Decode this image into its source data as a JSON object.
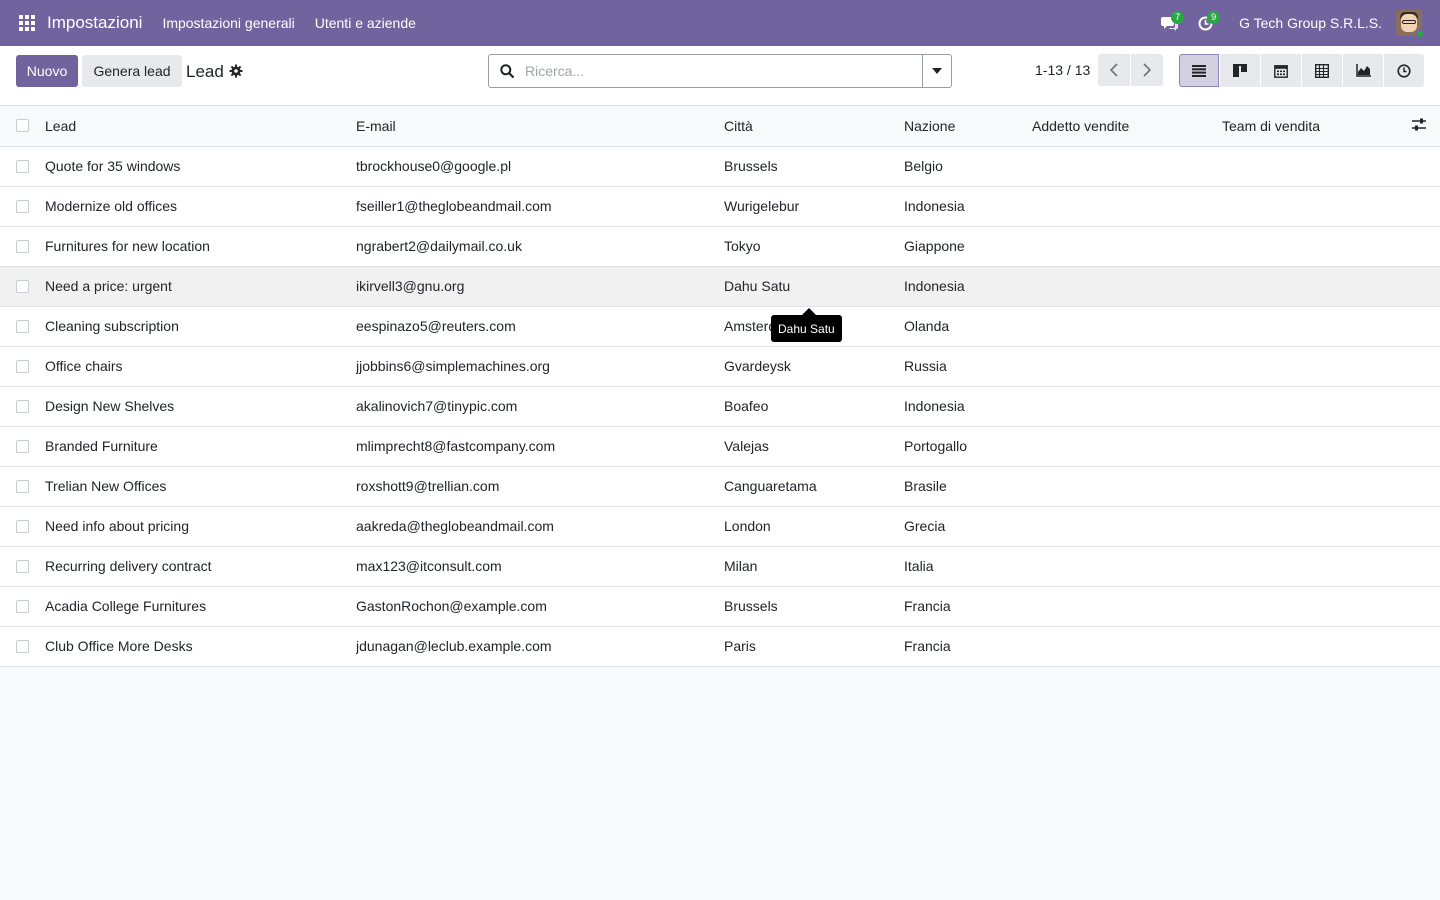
{
  "navbar": {
    "app_name": "Impostazioni",
    "menu": [
      "Impostazioni generali",
      "Utenti e aziende"
    ],
    "messages_count": "7",
    "activities_count": "9",
    "company": "G Tech Group S.R.L.S."
  },
  "control": {
    "new_label": "Nuovo",
    "generate_label": "Genera lead",
    "breadcrumb": "Lead",
    "search_placeholder": "Ricerca...",
    "pager": "1-13 / 13"
  },
  "columns": [
    "Lead",
    "E-mail",
    "Città",
    "Nazione",
    "Addetto vendite",
    "Team di vendita"
  ],
  "rows": [
    {
      "lead": "Quote for 35 windows",
      "email": "tbrockhouse0@google.pl",
      "city": "Brussels",
      "country": "Belgio",
      "salesperson": "",
      "team": ""
    },
    {
      "lead": "Modernize old offices",
      "email": "fseiller1@theglobeandmail.com",
      "city": "Wurigelebur",
      "country": "Indonesia",
      "salesperson": "",
      "team": ""
    },
    {
      "lead": "Furnitures for new location",
      "email": "ngrabert2@dailymail.co.uk",
      "city": "Tokyo",
      "country": "Giappone",
      "salesperson": "",
      "team": ""
    },
    {
      "lead": "Need a price: urgent",
      "email": "ikirvell3@gnu.org",
      "city": "Dahu Satu",
      "country": "Indonesia",
      "salesperson": "",
      "team": ""
    },
    {
      "lead": "Cleaning subscription",
      "email": "eespinazo5@reuters.com",
      "city": "Amsterdam",
      "country": "Olanda",
      "salesperson": "",
      "team": ""
    },
    {
      "lead": "Office chairs",
      "email": "jjobbins6@simplemachines.org",
      "city": "Gvardeysk",
      "country": "Russia",
      "salesperson": "",
      "team": ""
    },
    {
      "lead": "Design New Shelves",
      "email": "akalinovich7@tinypic.com",
      "city": "Boafeo",
      "country": "Indonesia",
      "salesperson": "",
      "team": ""
    },
    {
      "lead": "Branded Furniture",
      "email": "mlimprecht8@fastcompany.com",
      "city": "Valejas",
      "country": "Portogallo",
      "salesperson": "",
      "team": ""
    },
    {
      "lead": "Trelian New Offices",
      "email": "roxshott9@trellian.com",
      "city": "Canguaretama",
      "country": "Brasile",
      "salesperson": "",
      "team": ""
    },
    {
      "lead": "Need info about pricing",
      "email": "aakreda@theglobeandmail.com",
      "city": "London",
      "country": "Grecia",
      "salesperson": "",
      "team": ""
    },
    {
      "lead": "Recurring delivery contract",
      "email": "max123@itconsult.com",
      "city": "Milan",
      "country": "Italia",
      "salesperson": "",
      "team": ""
    },
    {
      "lead": "Acadia College Furnitures",
      "email": "GastonRochon@example.com",
      "city": "Brussels",
      "country": "Francia",
      "salesperson": "",
      "team": ""
    },
    {
      "lead": "Club Office More Desks",
      "email": "jdunagan@leclub.example.com",
      "city": "Paris",
      "country": "Francia",
      "salesperson": "",
      "team": ""
    }
  ],
  "tooltip": "Dahu Satu",
  "colors": {
    "brand": "#71639e",
    "badge": "#28a745"
  },
  "views": [
    "list-view-icon",
    "kanban-view-icon",
    "calendar-view-icon",
    "pivot-view-icon",
    "graph-view-icon",
    "activity-view-icon"
  ]
}
